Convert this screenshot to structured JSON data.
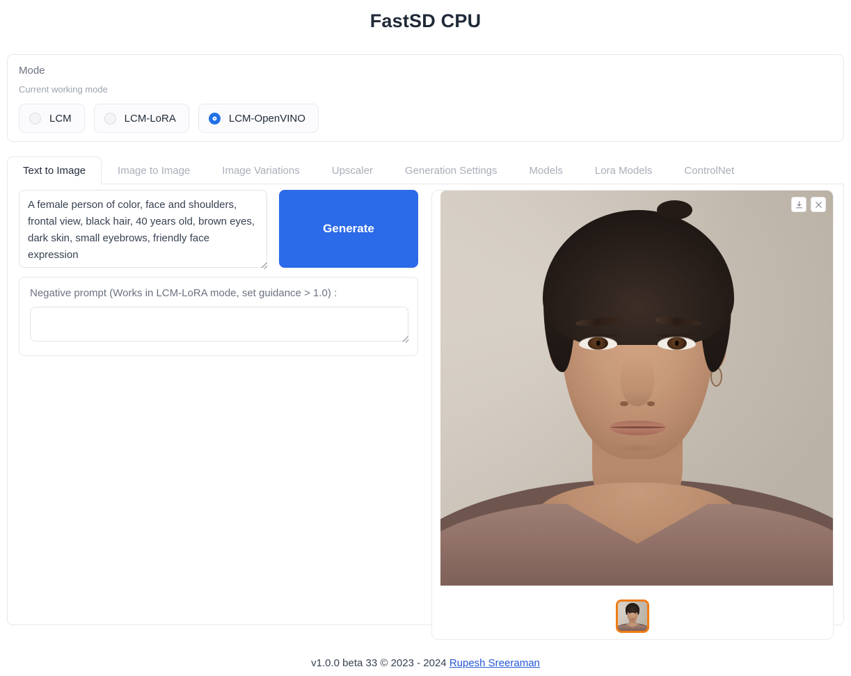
{
  "app": {
    "title": "FastSD CPU"
  },
  "mode": {
    "label": "Mode",
    "description": "Current working mode",
    "options": [
      {
        "label": "LCM",
        "selected": false
      },
      {
        "label": "LCM-LoRA",
        "selected": false
      },
      {
        "label": "LCM-OpenVINO",
        "selected": true
      }
    ],
    "selected": "LCM-OpenVINO"
  },
  "tabs": [
    {
      "label": "Text to Image",
      "active": true
    },
    {
      "label": "Image to Image",
      "active": false
    },
    {
      "label": "Image Variations",
      "active": false
    },
    {
      "label": "Upscaler",
      "active": false
    },
    {
      "label": "Generation Settings",
      "active": false
    },
    {
      "label": "Models",
      "active": false
    },
    {
      "label": "Lora Models",
      "active": false
    },
    {
      "label": "ControlNet",
      "active": false
    }
  ],
  "text_to_image": {
    "prompt": {
      "value": "A female person of color, face and shoulders, frontal view, black hair, 40 years old, brown eyes, dark skin, small eyebrows, friendly face expression",
      "placeholder": ""
    },
    "generate_label": "Generate",
    "negative_prompt": {
      "label": "Negative prompt (Works in LCM-LoRA mode, set guidance > 1.0) :",
      "value": "",
      "placeholder": ""
    }
  },
  "output": {
    "tools": [
      {
        "name": "download-icon",
        "title": "Download"
      },
      {
        "name": "close-icon",
        "title": "Clear"
      }
    ],
    "gallery": [
      {
        "selected": true,
        "alt": "Generated portrait of a woman, face and shoulders"
      }
    ],
    "image_alt": "Generated portrait of a woman of color, frontal view, black hair, brown eyes"
  },
  "footer": {
    "version_text": "v1.0.0 beta 33 © 2023 - 2024 ",
    "author_link": "Rupesh Sreeraman"
  },
  "colors": {
    "accent_blue": "#2b6ae8",
    "radio_blue": "#1f6fe5",
    "thumb_selected_orange": "#f07c16",
    "link_blue": "#2457d6",
    "border_gray": "#e8e8ec",
    "muted_text": "#9ca3af",
    "tab_inactive": "#a9aeb8"
  }
}
